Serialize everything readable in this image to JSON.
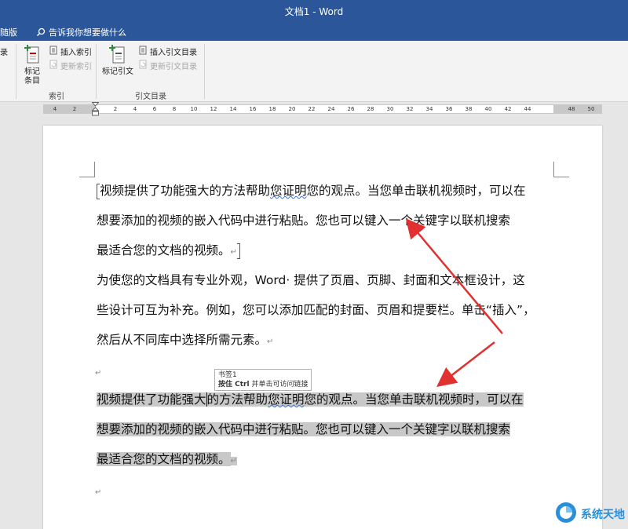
{
  "titlebar": {
    "title": "文档1 - Word"
  },
  "tellbar": {
    "left_tab": "随版",
    "tell_me": "告诉我你想要做什么"
  },
  "ribbon": {
    "left_cut_label": "录",
    "index_group": {
      "mark_entry_line1": "标记",
      "mark_entry_line2": "条目",
      "insert_index": "插入索引",
      "update_index": "更新索引",
      "label": "索引"
    },
    "toa_group": {
      "mark_citation": "标记引文",
      "insert_toa": "插入引文目录",
      "update_toa": "更新引文目录",
      "label": "引文目录"
    }
  },
  "ruler": {
    "ticks": [
      "4",
      "2",
      "2",
      "4",
      "6",
      "8",
      "10",
      "12",
      "14",
      "16",
      "18",
      "20",
      "22",
      "24",
      "26",
      "28",
      "30",
      "32",
      "34",
      "36",
      "38",
      "40",
      "42",
      "44",
      "48",
      "50"
    ]
  },
  "document": {
    "p1_line1": "视频提供了功能强大的方法帮助您证明您的观点。当您单击联机视频时，可以在",
    "p1_line2": "想要添加的视频的嵌入代码中进行粘贴。您也可以键入一个关键字以联机搜索",
    "p1_line3": "最适合您的文档的视频。",
    "p2_line1": "为使您的文档具有专业外观，Word· 提供了页眉、页脚、封面和文本框设计，这",
    "p2_line2": "些设计可互为补充。例如，您可以添加匹配的封面、页眉和提要栏。单击“插入”，",
    "p2_line3": "然后从不同库中选择所需元素。",
    "p3_line1_a": "视频提供了功能强大",
    "p3_line1_b": "的方法帮助",
    "p3_line1_c": "您证明",
    "p3_line1_d": "您的观点。当您单击联机视频时，可以在",
    "p3_line2": "想要添加的视频的嵌入代码中进行粘贴。您也可以键入一个关键字以联机搜索",
    "p3_line3": "最适合您的文档的视频。",
    "para_mark": "↵",
    "p1_line1_pre": "视频提供了功能强大的方法帮助",
    "p1_line1_sq": "您证明",
    "p1_line1_post": "您的观点。当您单击联机视频时，可以在"
  },
  "tooltip": {
    "line1": "书签1",
    "line2_key": "按住 Ctrl",
    "line2_rest": " 并单击可访问链接"
  },
  "watermark": {
    "text": "系统天地"
  },
  "colors": {
    "titlebar": "#2b579a",
    "highlight": "#c8c8c8",
    "arrow": "#e03030"
  }
}
